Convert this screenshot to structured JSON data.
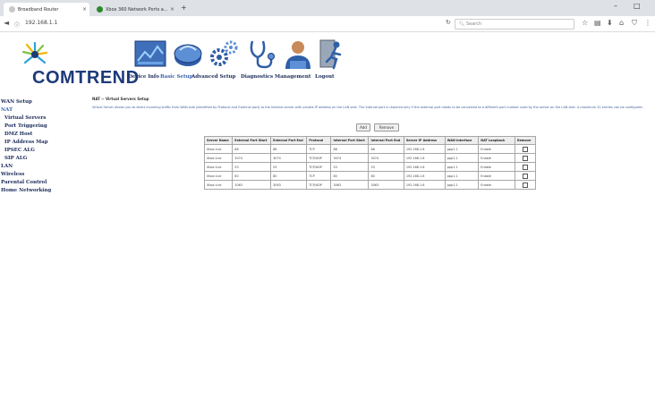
{
  "browser": {
    "tabs": [
      {
        "label": "Broadband Router",
        "close": "×"
      },
      {
        "label": "Xbox 360 Network Ports a...",
        "close": "×"
      }
    ],
    "new_tab": "+",
    "url": "192.168.1.1",
    "search_placeholder": "Search",
    "window_controls": [
      "–",
      "□"
    ]
  },
  "router": {
    "brand": "COMTREND",
    "nav": [
      {
        "label": "Device Info",
        "icon": "device-info-icon"
      },
      {
        "label": "Basic Setup",
        "icon": "basic-setup-icon",
        "active": true
      },
      {
        "label": "Advanced Setup",
        "icon": "advanced-setup-icon"
      },
      {
        "label": "Diagnostics",
        "icon": "diagnostics-icon"
      },
      {
        "label": "Management",
        "icon": "management-icon"
      },
      {
        "label": "Logout",
        "icon": "logout-icon"
      }
    ],
    "sidebar": [
      {
        "label": "WAN Setup"
      },
      {
        "label": "NAT",
        "active": true
      },
      {
        "label": "Virtual Servers"
      },
      {
        "label": "Port Triggering"
      },
      {
        "label": "DMZ Host"
      },
      {
        "label": "IP Address Map"
      },
      {
        "label": "IPSEC ALG"
      },
      {
        "label": "SIP ALG"
      },
      {
        "label": "LAN"
      },
      {
        "label": "Wireless"
      },
      {
        "label": "Parental Control"
      },
      {
        "label": "Home Networking"
      }
    ]
  },
  "content": {
    "breadcrumb": "NAT -- Virtual Servers Setup",
    "description": "Virtual Server allows you to direct incoming traffic from WAN side (identified by Protocol and External port) to the Internal server with private IP address on the LAN side. The Internal port is required only if the external port needs to be converted to a different port number used by the server on the LAN side. A maximum 32 entries can be configured.",
    "add_label": "Add",
    "remove_label": "Remove",
    "table": {
      "headers": [
        "Server Name",
        "External Port Start",
        "External Port End",
        "Protocol",
        "Internal Port Start",
        "Internal Port End",
        "Server IP Address",
        "WAN Interface",
        "NAT Loopback",
        "Remove"
      ],
      "rows": [
        [
          "Xbox Live",
          "88",
          "88",
          "TCP",
          "88",
          "88",
          "192.168.1.6",
          "ppp1.1",
          "Enable"
        ],
        [
          "Xbox Live",
          "3074",
          "3074",
          "TCP/UDP",
          "3074",
          "3074",
          "192.168.1.6",
          "ppp1.1",
          "Enable"
        ],
        [
          "Xbox Live",
          "53",
          "53",
          "TCP/UDP",
          "53",
          "53",
          "192.168.1.6",
          "ppp1.1",
          "Enable"
        ],
        [
          "Xbox Live",
          "80",
          "80",
          "TCP",
          "80",
          "80",
          "192.168.1.6",
          "ppp1.1",
          "Enable"
        ],
        [
          "Xbox Live",
          "3063",
          "3063",
          "TCP/UDP",
          "3063",
          "3063",
          "192.168.1.6",
          "ppp1.1",
          "Enable"
        ]
      ]
    }
  }
}
